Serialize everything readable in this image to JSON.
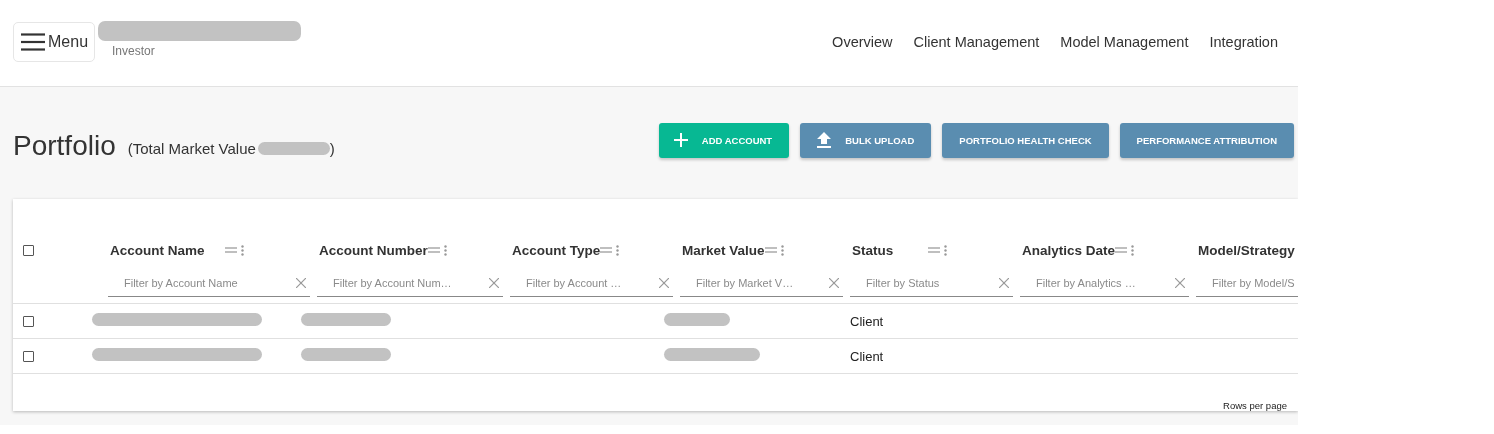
{
  "header": {
    "menu_button": {
      "label": "Menu"
    },
    "role": "Investor",
    "nav": [
      {
        "label": "Overview"
      },
      {
        "label": "Client Management"
      },
      {
        "label": "Model Management"
      },
      {
        "label": "Integration"
      }
    ]
  },
  "page": {
    "title": "Portfolio",
    "subtitle_before": "(Total Market Value",
    "subtitle_after": ")"
  },
  "actions": [
    {
      "label": "ADD ACCOUNT",
      "kind": "add"
    },
    {
      "label": "BULK UPLOAD",
      "kind": "upload"
    },
    {
      "label": "PORTFOLIO HEALTH CHECK",
      "kind": "plain"
    },
    {
      "label": "PERFORMANCE ATTRIBUTION",
      "kind": "plain"
    }
  ],
  "table": {
    "select_all": {
      "checked": false
    },
    "columns": [
      {
        "label": "Account Name",
        "filter_placeholder": "Filter by Account Name",
        "icons_visible": true
      },
      {
        "label": "Account Number",
        "filter_placeholder": "Filter by Account Num…",
        "icons_visible": true
      },
      {
        "label": "Account Type",
        "filter_placeholder": "Filter by Account …",
        "icons_visible": true
      },
      {
        "label": "Market Value",
        "filter_placeholder": "Filter by Market V…",
        "icons_visible": true
      },
      {
        "label": "Status",
        "filter_placeholder": "Filter by Status",
        "icons_visible": true
      },
      {
        "label": "Analytics Date",
        "filter_placeholder": "Filter by Analytics …",
        "icons_visible": true
      },
      {
        "label": "Model/Strategy",
        "filter_placeholder": "Filter by Model/S",
        "icons_visible": false
      }
    ],
    "rows": [
      {
        "checked": false,
        "cells": [
          {
            "kind": "redacted"
          },
          {
            "kind": "redacted"
          },
          {
            "kind": "empty"
          },
          {
            "kind": "redacted"
          },
          {
            "kind": "text",
            "text": "Client"
          },
          {
            "kind": "empty"
          },
          {
            "kind": "empty"
          }
        ]
      },
      {
        "checked": false,
        "cells": [
          {
            "kind": "redacted"
          },
          {
            "kind": "redacted"
          },
          {
            "kind": "empty"
          },
          {
            "kind": "redacted"
          },
          {
            "kind": "text",
            "text": "Client"
          },
          {
            "kind": "empty"
          },
          {
            "kind": "empty"
          }
        ]
      }
    ],
    "footer": {
      "rows_per_page_label": "Rows per page"
    }
  }
}
